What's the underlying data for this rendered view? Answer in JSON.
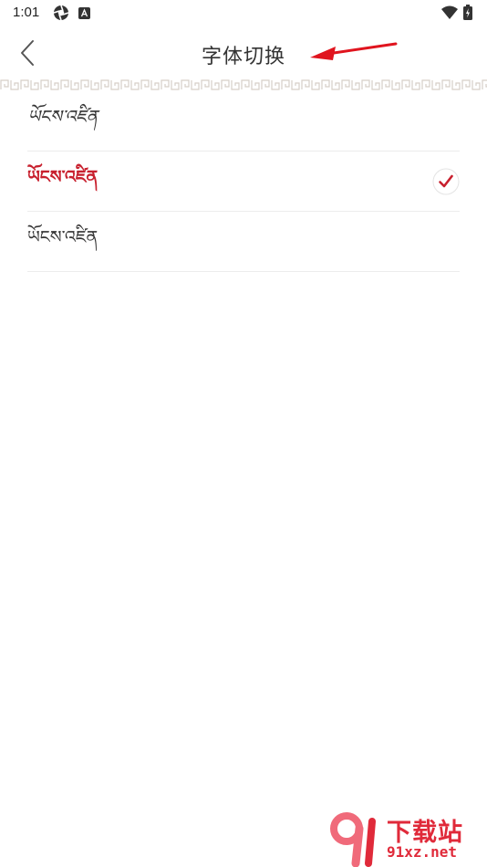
{
  "status_bar": {
    "time": "1:01"
  },
  "header": {
    "title": "字体切换"
  },
  "fonts": {
    "items": [
      {
        "label": "ཡོངས་འཛིན",
        "selected": false
      },
      {
        "label": "ཡོངས་འཛིན",
        "selected": true
      },
      {
        "label": "ཡོངས་འཛིན",
        "selected": false
      }
    ]
  },
  "colors": {
    "accent": "#c8202e",
    "annotation_arrow": "#e0141e"
  },
  "watermark": {
    "brand": "下载站",
    "domain": "91xz.net"
  }
}
